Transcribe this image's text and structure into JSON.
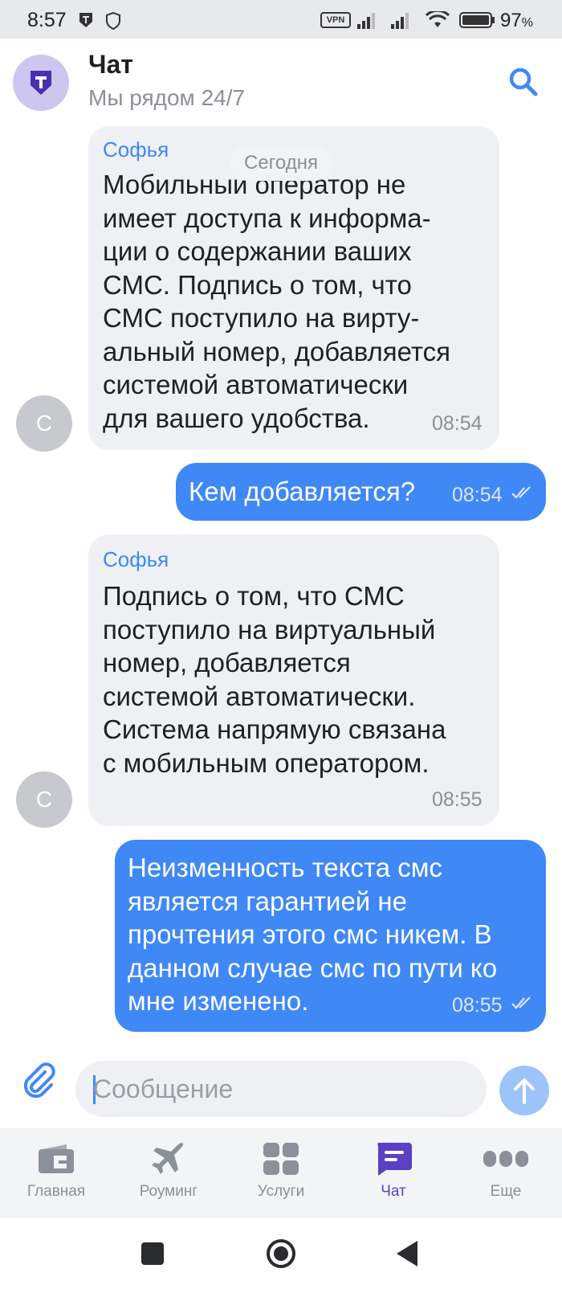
{
  "status_bar": {
    "time": "8:57",
    "vpn_label": "VPN",
    "battery_percent": "97",
    "battery_suffix": "%",
    "icons": [
      "t-app-icon",
      "shield-icon",
      "vpn-icon",
      "signal-icon",
      "signal-icon",
      "wifi-icon",
      "battery-icon"
    ]
  },
  "header": {
    "title": "Чат",
    "subtitle": "Мы рядом 24/7",
    "avatar_icon": "brand-t-icon",
    "search_icon": "search-icon"
  },
  "chat": {
    "date_separator": "Сегодня",
    "messages": [
      {
        "direction": "incoming",
        "sender": "Софья",
        "avatar_letter": "С",
        "text": "Мобильный оператор не\nимеет доступа к информа-\nции о содержании ваших\nСМС. Подпись о том, что\nСМС поступило на вирту-\nальный номер, добавляется\nсистемой автоматически\nдля вашего удобства.",
        "time": "08:54"
      },
      {
        "direction": "outgoing",
        "text": "Кем добавляется?",
        "time": "08:54",
        "status": "read"
      },
      {
        "direction": "incoming",
        "sender": "Софья",
        "avatar_letter": "С",
        "text": "Подпись о том, что СМС\nпоступило на виртуальный\nномер, добавляется\nсистемой автоматически.\nСистема напрямую связана\nс мобильным оператором.",
        "time": "08:55"
      },
      {
        "direction": "outgoing",
        "text": "Неизменность текста смс\nявляется гарантией не\nпрочтения этого смс никем. В\nданном случае смс по пути ко\nмне изменено.",
        "time": "08:55",
        "status": "read"
      }
    ]
  },
  "composer": {
    "placeholder": "Сообщение",
    "value": "",
    "attach_icon": "paperclip-icon",
    "send_icon": "arrow-up-icon"
  },
  "bottom_nav": {
    "items": [
      {
        "label": "Главная",
        "icon": "home-card-icon",
        "active": false
      },
      {
        "label": "Роуминг",
        "icon": "airplane-icon",
        "active": false
      },
      {
        "label": "Услуги",
        "icon": "grid-icon",
        "active": false
      },
      {
        "label": "Чат",
        "icon": "chat-icon",
        "active": true
      },
      {
        "label": "Еще",
        "icon": "more-icon",
        "active": false
      }
    ]
  },
  "colors": {
    "accent_blue": "#3f88f6",
    "brand_purple": "#5b3fc4",
    "incoming_bubble": "#eff0f3"
  }
}
